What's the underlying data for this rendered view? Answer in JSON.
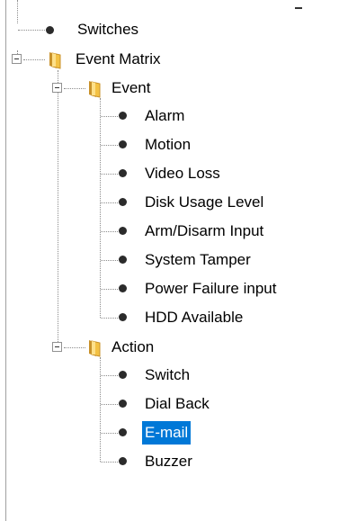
{
  "tree": {
    "switches_label": "Switches",
    "event_matrix": {
      "label": "Event Matrix",
      "event": {
        "label": "Event",
        "items": [
          "Alarm",
          "Motion",
          "Video Loss",
          "Disk Usage Level",
          "Arm/Disarm Input",
          "System Tamper",
          "Power Failure input",
          "HDD Available"
        ]
      },
      "action": {
        "label": "Action",
        "items": [
          "Switch",
          "Dial Back",
          "E-mail",
          "Buzzer"
        ],
        "selected": "E-mail"
      }
    }
  },
  "colors": {
    "selection": "#0078d7",
    "folder": "#f3c144"
  }
}
